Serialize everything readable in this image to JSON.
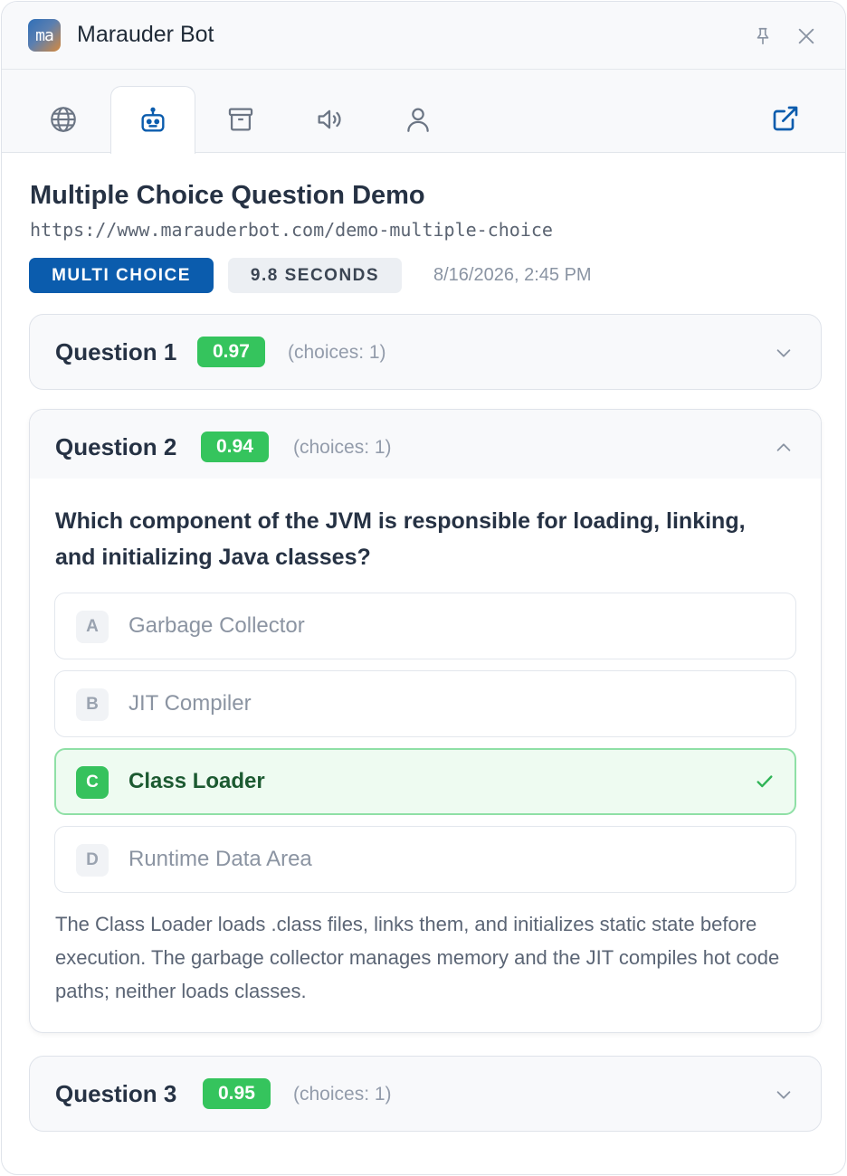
{
  "app": {
    "logo_text": "ma",
    "title": "Marauder Bot"
  },
  "titlebar_icons": {
    "pin": "pin-icon",
    "close": "close-icon"
  },
  "tabs": [
    {
      "icon": "globe-icon",
      "active": false
    },
    {
      "icon": "robot-icon",
      "active": true
    },
    {
      "icon": "archive-icon",
      "active": false
    },
    {
      "icon": "speaker-icon",
      "active": false
    },
    {
      "icon": "user-icon",
      "active": false
    }
  ],
  "external_link_icon": "external-link-icon",
  "page": {
    "title": "Multiple Choice Question Demo",
    "url": "https://www.marauderbot.com/demo-multiple-choice",
    "type_badge": "MULTI CHOICE",
    "time_badge": "9.8 SECONDS",
    "timestamp": "8/16/2026, 2:45 PM"
  },
  "questions": [
    {
      "label": "Question 1",
      "score": "0.97",
      "choices": "(choices: 1)",
      "expanded": false
    },
    {
      "label": "Question 2",
      "score": "0.94",
      "choices": "(choices: 1)",
      "expanded": true,
      "text": "Which component of the JVM is responsible for loading, linking, and initializing Java classes?",
      "options": [
        {
          "letter": "A",
          "text": "Garbage Collector",
          "correct": false
        },
        {
          "letter": "B",
          "text": "JIT Compiler",
          "correct": false
        },
        {
          "letter": "C",
          "text": "Class Loader",
          "correct": true
        },
        {
          "letter": "D",
          "text": "Runtime Data Area",
          "correct": false
        }
      ],
      "explanation": "The Class Loader loads .class files, links them, and initializes static state before execution. The garbage collector manages memory and the JIT compiles hot code paths; neither loads classes."
    },
    {
      "label": "Question 3",
      "score": "0.95",
      "choices": "(choices: 1)",
      "expanded": false
    }
  ],
  "colors": {
    "primary_badge": "#0b5cad",
    "score_green": "#35c45d",
    "correct_bg": "#eefbf1",
    "correct_border": "#8fe0a6"
  }
}
